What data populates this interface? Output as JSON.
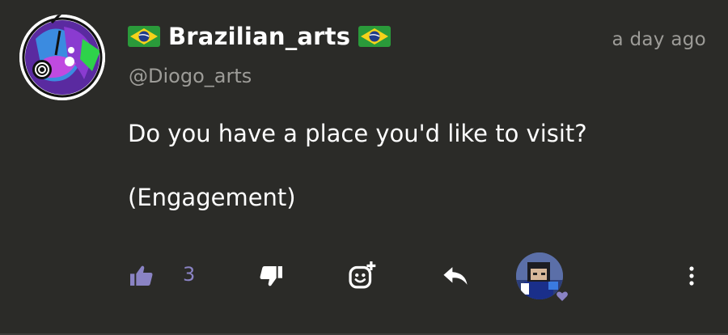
{
  "post": {
    "author": {
      "display_name": "Brazilian_arts",
      "handle": "@Diogo_arts",
      "flag_icon": "brazil-flag-icon"
    },
    "timestamp": "a day ago",
    "body_lines": [
      "Do you have a place you'd like to visit?",
      "(Engagement)"
    ]
  },
  "actions": {
    "like_count": "3",
    "like_icon": "thumbs-up-icon",
    "dislike_icon": "thumbs-down-icon",
    "react_icon": "add-reaction-icon",
    "reply_icon": "reply-icon",
    "more_icon": "more-vertical-icon"
  },
  "colors": {
    "background": "#2b2b28",
    "text": "#ffffff",
    "muted": "#9d9c98",
    "accent": "#8a83c4"
  }
}
